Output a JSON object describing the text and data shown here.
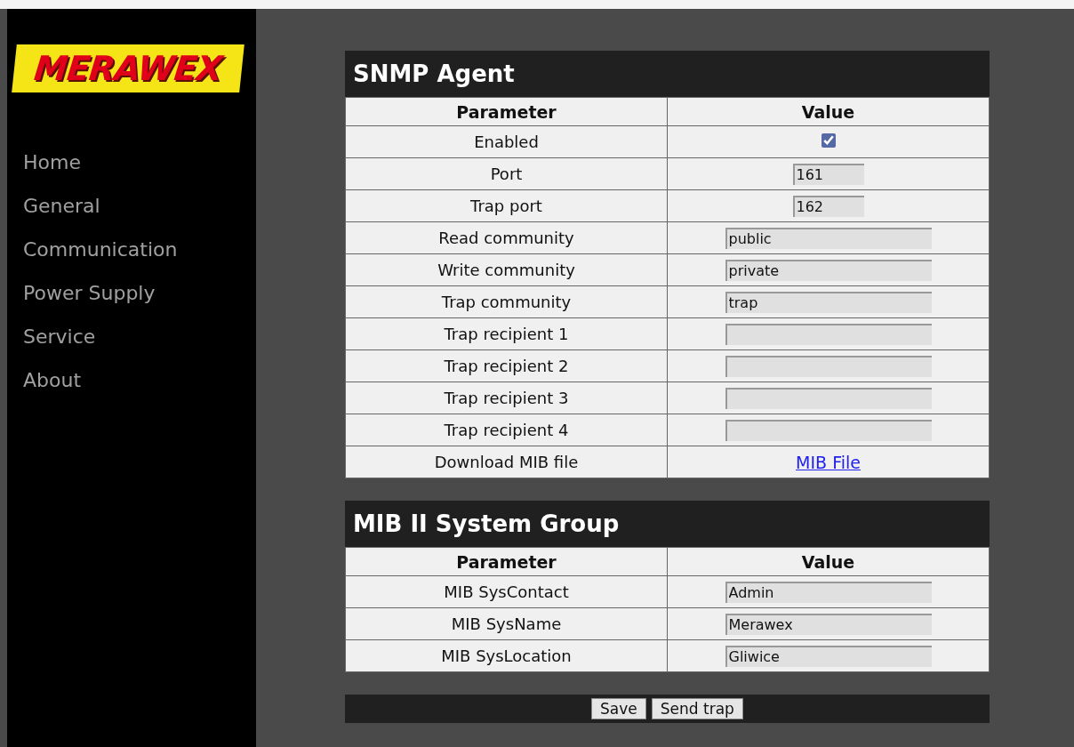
{
  "logo": {
    "text": "MERAWEX"
  },
  "nav": [
    {
      "label": "Home"
    },
    {
      "label": "General"
    },
    {
      "label": "Communication"
    },
    {
      "label": "Power Supply"
    },
    {
      "label": "Service"
    },
    {
      "label": "About"
    }
  ],
  "sections": [
    {
      "title": "SNMP Agent",
      "columns": [
        "Parameter",
        "Value"
      ],
      "rows": [
        {
          "label": "Enabled",
          "kind": "checkbox",
          "checked": true
        },
        {
          "label": "Port",
          "kind": "short-field",
          "value": "161"
        },
        {
          "label": "Trap port",
          "kind": "short-field",
          "value": "162"
        },
        {
          "label": "Read community",
          "kind": "field",
          "value": "public"
        },
        {
          "label": "Write community",
          "kind": "field",
          "value": "private"
        },
        {
          "label": "Trap community",
          "kind": "field",
          "value": "trap"
        },
        {
          "label": "Trap recipient 1",
          "kind": "field"
        },
        {
          "label": "Trap recipient 2",
          "kind": "field"
        },
        {
          "label": "Trap recipient 3",
          "kind": "field"
        },
        {
          "label": "Trap recipient 4",
          "kind": "field"
        },
        {
          "label": "Download MIB file",
          "kind": "link",
          "value": "MIB File"
        }
      ]
    },
    {
      "title": "MIB II System Group",
      "columns": [
        "Parameter",
        "Value"
      ],
      "rows": [
        {
          "label": "MIB SysContact",
          "kind": "field",
          "value": "Admin"
        },
        {
          "label": "MIB SysName",
          "kind": "field",
          "value": "Merawex"
        },
        {
          "label": "MIB SysLocation",
          "kind": "field",
          "value": "Gliwice"
        }
      ]
    }
  ],
  "buttons": [
    "Save",
    "Send trap"
  ]
}
